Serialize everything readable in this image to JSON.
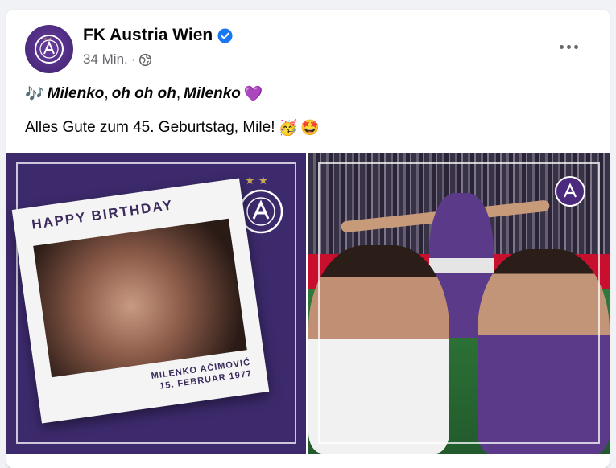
{
  "post": {
    "page_name": "FK Austria Wien",
    "time": "34 Min.",
    "separator": "·",
    "text_line1": {
      "lead_emoji": "🎶",
      "part1": "Milenko",
      "comma1": ",",
      "part2": "oh oh oh",
      "comma2": ",",
      "part3": "Milenko",
      "end_emoji": "💜"
    },
    "text_line2": {
      "text": "Alles Gute zum 45. Geburtstag, Mile!",
      "emoji1": "🥳",
      "emoji2": "🤩"
    }
  },
  "image_left": {
    "headline": "HAPPY BIRTHDAY",
    "caption_name": "MILENKO AČIMOVIĆ",
    "caption_date": "15. FEBRUAR 1977",
    "stars": "★★"
  },
  "icons": {
    "avatar": "club-crest-icon",
    "verified": "verified-badge-icon",
    "audience": "globe-icon",
    "more": "more-options-icon"
  },
  "colors": {
    "verified_blue": "#1877f2",
    "club_purple": "#4b2a7d",
    "text_secondary": "#65676b"
  }
}
